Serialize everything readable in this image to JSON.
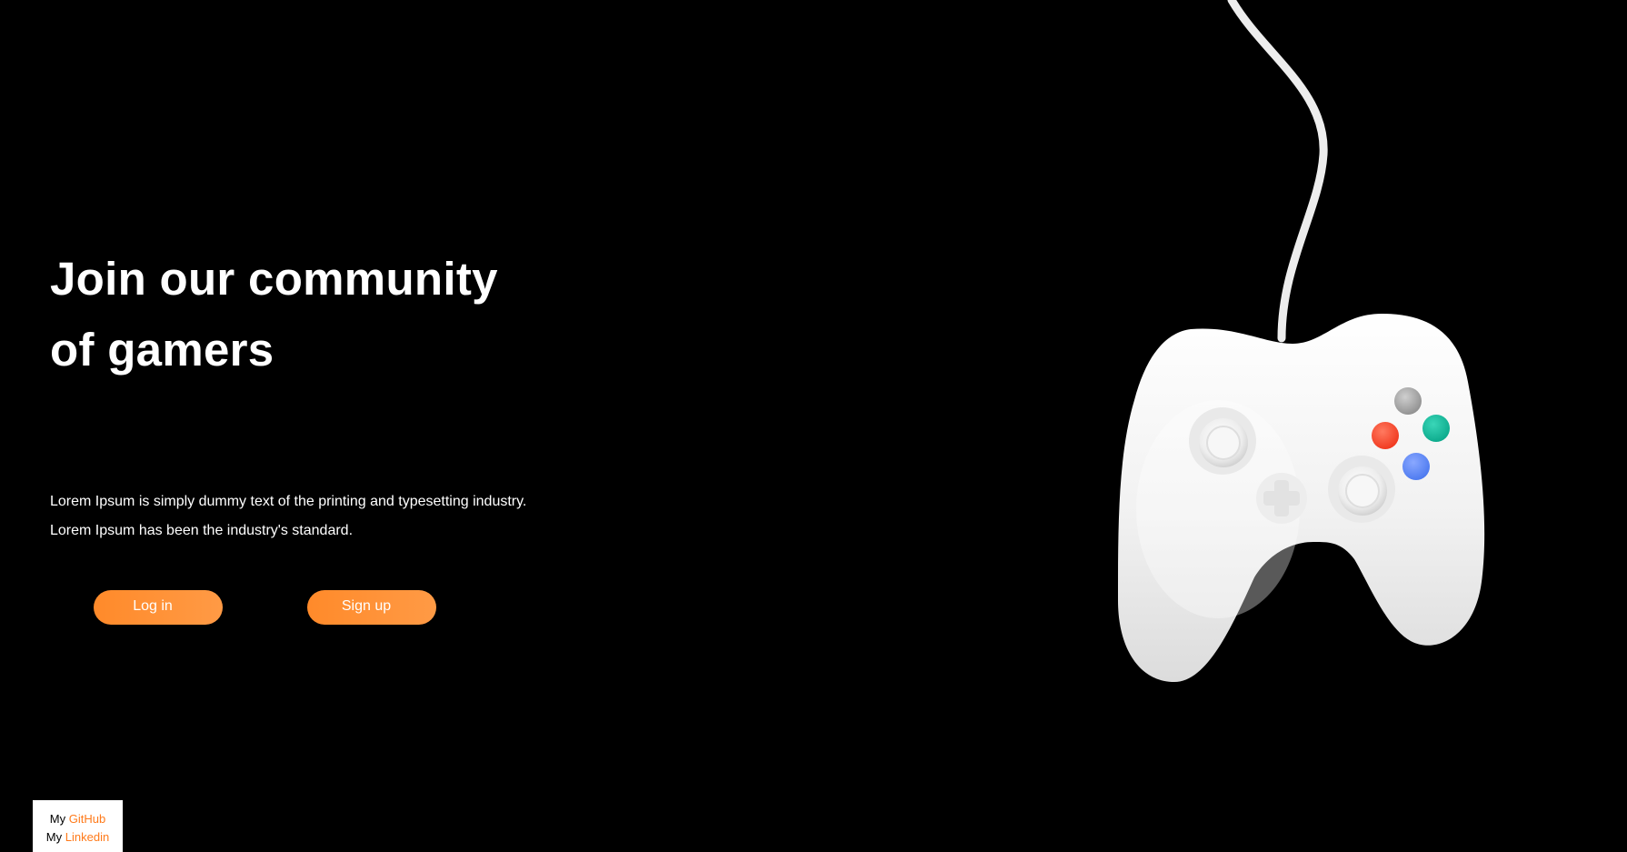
{
  "hero": {
    "title_line1": "Join our community",
    "title_line2": "of gamers",
    "text_line1": "Lorem Ipsum is simply dummy text of the printing and typesetting industry.",
    "text_line2": "Lorem Ipsum has been the industry's standard."
  },
  "buttons": {
    "login_label": "Log in",
    "signup_label": "Sign up"
  },
  "footer_links": {
    "github_prefix": "My",
    "github_label": "GitHub",
    "linkedin_prefix": "My",
    "linkedin_label": "Linkedin"
  },
  "image": {
    "subject": "game-controller-icon"
  },
  "colors": {
    "background": "#000000",
    "accent": "#ff8a2a",
    "text": "#ffffff",
    "link": "#ff7a1a"
  }
}
